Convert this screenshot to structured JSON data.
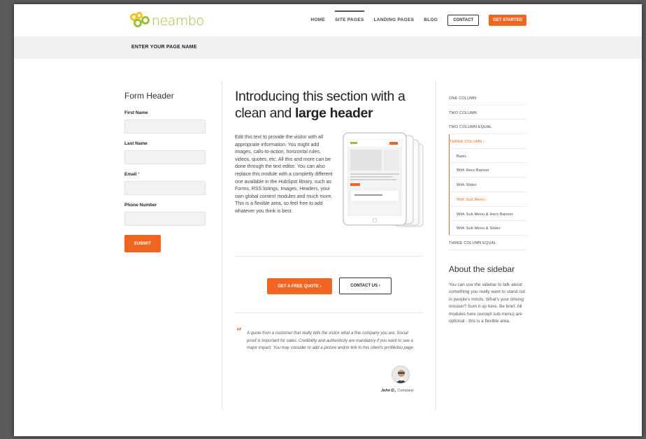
{
  "brand": {
    "name": "neambo",
    "colors": {
      "accent": "#f16522",
      "logo_green": "#9bbf3a",
      "logo_yellow": "#f2c320"
    }
  },
  "nav": {
    "items": [
      {
        "label": "HOME"
      },
      {
        "label": "SITE PAGES"
      },
      {
        "label": "LANDING PAGES"
      },
      {
        "label": "BLOG"
      }
    ],
    "contact_label": "CONTACT",
    "get_started_label": "GET STARTED"
  },
  "page_name": "ENTER YOUR PAGE NAME",
  "form": {
    "header": "Form Header",
    "fields": [
      {
        "label": "First Name",
        "required": false
      },
      {
        "label": "Last Name",
        "required": false
      },
      {
        "label": "Email",
        "required": true
      },
      {
        "label": "Phone Number",
        "required": false
      }
    ],
    "required_mark": "*",
    "submit_label": "SUBMIT"
  },
  "main": {
    "headline_line1": "Introducing this section with a",
    "headline_line2_plain": "clean and ",
    "headline_line2_bold": "large header",
    "body": "Edit this text to provide the visitor with all appropriate information. You might add images, calls-to-action, horizontal rules, videos, quotes, etc. All this and more can be done through the text editor. You can also replace this module with a completly different one available in the HubSpot library, such as Forms, RSS listings, Images, Headers, your own global content modules and much more. This is a flexible area, so feel free to add whatever you think is best.",
    "cta_primary": "GET A FREE QUOTE ›",
    "cta_secondary": "CONTACT US ›",
    "quote": "A quote from a customer that really tells the visitor what a fine company you are. Social proof is important for sales. Credibility and authenticity are mandatory if you want to see a major impact. You may consider to add a picture and/or link to this client's profile/bio page.",
    "quote_icon": "quote-icon",
    "author_name": "John D.,",
    "author_company": "Company"
  },
  "sidebar": {
    "items": [
      {
        "label": "ONE COLUMN",
        "level": 0,
        "active": false
      },
      {
        "label": "TWO COLUMN",
        "level": 0,
        "active": false
      },
      {
        "label": "TWO COLUMN EQUAL",
        "level": 0,
        "active": false
      },
      {
        "label": "THREE COLUMN ›",
        "level": 0,
        "active": true
      },
      {
        "label": "Basic",
        "level": 1,
        "active": false
      },
      {
        "label": "With Hero Banner",
        "level": 1,
        "active": false
      },
      {
        "label": "With Slider",
        "level": 1,
        "active": false
      },
      {
        "label": "With Sub Menu ›",
        "level": 1,
        "active": true
      },
      {
        "label": "With Sub Menu & Hero Banner",
        "level": 1,
        "active": false
      },
      {
        "label": "With Sub Menu & Slider",
        "level": 1,
        "active": false
      },
      {
        "label": "THREE COLUMN EQUAL",
        "level": 0,
        "active": false
      }
    ],
    "about_title": "About the sidebar",
    "about_text": "You can use the sidebar to talk about something you really want to stand out in people's minds. What's your driving mission? Sum it up here. Be brief. All modules here (except sub-menu) are optional - this is a flexible area."
  }
}
